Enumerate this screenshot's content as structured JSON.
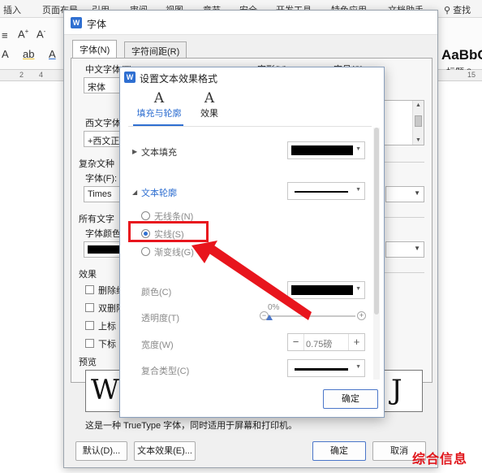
{
  "app": {
    "ribbon_tabs": [
      "插入",
      "页面布局",
      "引用",
      "审阅",
      "视图",
      "章节",
      "安全",
      "开发工具",
      "特色应用",
      "文档助手"
    ],
    "search_label": "查找",
    "style_sample": "AaBbC",
    "style_name": "标题 3",
    "ruler_numbers": [
      "2",
      "4",
      "15"
    ]
  },
  "font_dialog": {
    "title": "字体",
    "tabs": [
      "字体(N)",
      "字符间距(R)"
    ],
    "chinese_font_label": "中文字体(T)",
    "chinese_font_value": "宋体",
    "style_label": "字形(Y)",
    "size_label": "字号(S)",
    "western_font_label": "西文字体",
    "western_font_value": "+西文正",
    "complex_section": "复杂文种",
    "complex_font_label": "字体(F):",
    "complex_font_value": "Times",
    "all_text_section": "所有文字",
    "font_color_label": "字体颜色",
    "effects_section": "效果",
    "effect_checkboxes": [
      "删除线",
      "双删除",
      "上标",
      "下标"
    ],
    "preview_label": "预览",
    "info_text": "这是一种 TrueType 字体，同时适用于屏幕和打印机。",
    "buttons": {
      "default": "默认(D)...",
      "text_effects": "文本效果(E)...",
      "ok": "确定",
      "cancel": "取消"
    }
  },
  "effects_dialog": {
    "title": "设置文本效果格式",
    "tabs": [
      {
        "icon": "A",
        "label": "填充与轮廓",
        "active": true
      },
      {
        "icon": "A",
        "label": "效果",
        "active": false
      }
    ],
    "text_fill_label": "文本填充",
    "text_outline_label": "文本轮廓",
    "radio_options": [
      {
        "label": "无线条(N)",
        "checked": false
      },
      {
        "label": "实线(S)",
        "checked": true
      },
      {
        "label": "渐变线(G)",
        "checked": false
      }
    ],
    "color_label": "颜色(C)",
    "transparency_label": "透明度(T)",
    "transparency_value": "0%",
    "transparency_percent": 0,
    "width_label": "宽度(W)",
    "width_value": "0.75磅",
    "compound_label": "复合类型(C)",
    "ok_button": "确定",
    "fill_color": "#000000",
    "accent_color": "#2f6fd1"
  },
  "annotation": {
    "highlight_color": "#e8151d"
  },
  "watermark": "综合信息"
}
